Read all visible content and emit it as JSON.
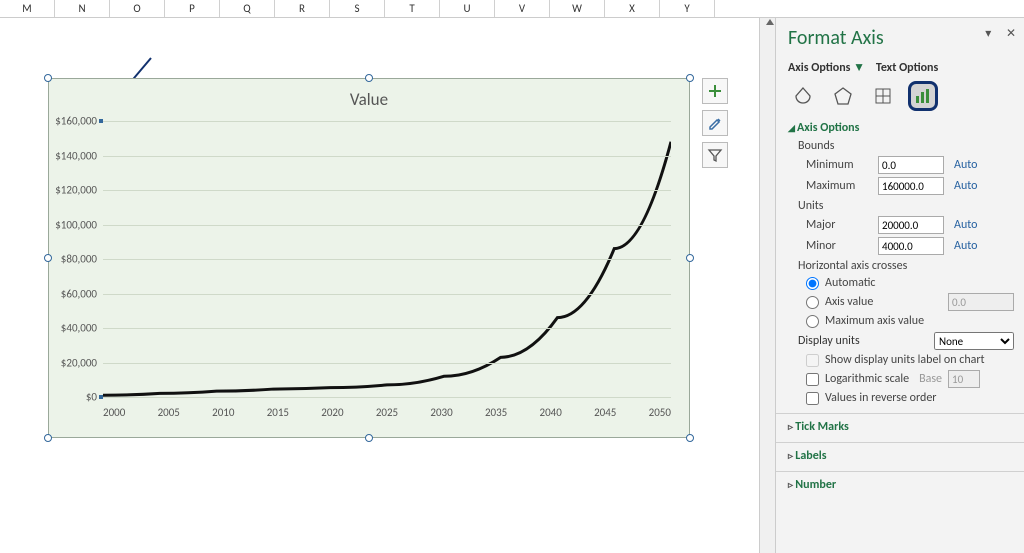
{
  "columns": [
    "M",
    "N",
    "O",
    "P",
    "Q",
    "R",
    "S",
    "T",
    "U",
    "V",
    "W",
    "X",
    "Y"
  ],
  "chart_data": {
    "type": "line",
    "title": "Value",
    "xlabel": "",
    "ylabel": "",
    "xlim": [
      2000,
      2050
    ],
    "ylim": [
      0,
      160000
    ],
    "x_ticks": [
      2000,
      2005,
      2010,
      2015,
      2020,
      2025,
      2030,
      2035,
      2040,
      2045,
      2050
    ],
    "y_ticks": [
      "$0",
      "$20,000",
      "$40,000",
      "$60,000",
      "$80,000",
      "$100,000",
      "$120,000",
      "$140,000",
      "$160,000"
    ],
    "x": [
      2000,
      2005,
      2010,
      2015,
      2020,
      2025,
      2030,
      2035,
      2040,
      2045,
      2050
    ],
    "values": [
      1000,
      2100,
      3400,
      4600,
      5400,
      7000,
      12000,
      23000,
      46000,
      86000,
      148000
    ]
  },
  "chart_tools": {
    "add": "plus-icon",
    "style": "brush-icon",
    "filter": "funnel-icon"
  },
  "pane": {
    "title": "Format Axis",
    "tabs": {
      "options": "Axis Options",
      "text": "Text Options"
    },
    "section": {
      "axis_options": "Axis Options",
      "bounds": "Bounds",
      "units": "Units",
      "hcross": "Horizontal axis crosses",
      "tick": "Tick Marks",
      "labels": "Labels",
      "number": "Number"
    },
    "fields": {
      "minimum_label": "Minimum",
      "minimum_value": "0.0",
      "maximum_label": "Maximum",
      "maximum_value": "160000.0",
      "major_label": "Major",
      "major_value": "20000.0",
      "minor_label": "Minor",
      "minor_value": "4000.0",
      "auto": "Auto",
      "cross_auto": "Automatic",
      "cross_val": "Axis value",
      "cross_val_value": "0.0",
      "cross_max": "Maximum axis value",
      "display_units": "Display units",
      "display_units_value": "None",
      "show_du_label": "Show display units label on chart",
      "log_scale": "Logarithmic scale",
      "log_base_label": "Base",
      "log_base_value": "10",
      "reverse": "Values in reverse order"
    }
  }
}
